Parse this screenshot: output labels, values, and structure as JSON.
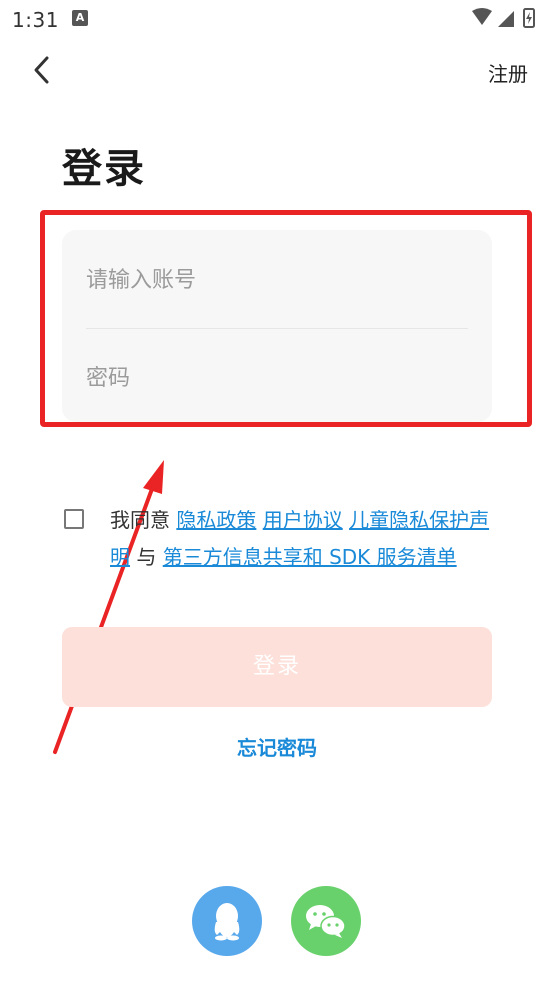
{
  "status_bar": {
    "time": "1:31",
    "app_icon_letter": "A"
  },
  "header": {
    "back_icon": "chevron-left-icon",
    "register_label": "注册"
  },
  "title": "登录",
  "form": {
    "account_placeholder": "请输入账号",
    "account_value": "",
    "password_placeholder": "密码",
    "password_value": ""
  },
  "agreement": {
    "checked": false,
    "prefix": "我同意",
    "privacy_policy": "隐私政策",
    "user_agreement": "用户协议",
    "child_privacy": "儿童隐私保护声明",
    "and": "与",
    "third_party": "第三方信息共享和 SDK 服务清单"
  },
  "login_button_label": "登录",
  "forgot_password_label": "忘记密码",
  "social": {
    "qq_icon": "qq-icon",
    "wechat_icon": "wechat-icon"
  },
  "colors": {
    "accent_link": "#1a8ad8",
    "login_button_bg": "#fde0d9",
    "annotation_red": "#ea2424",
    "qq_blue": "#58a8ec",
    "wechat_green": "#69d16c"
  }
}
